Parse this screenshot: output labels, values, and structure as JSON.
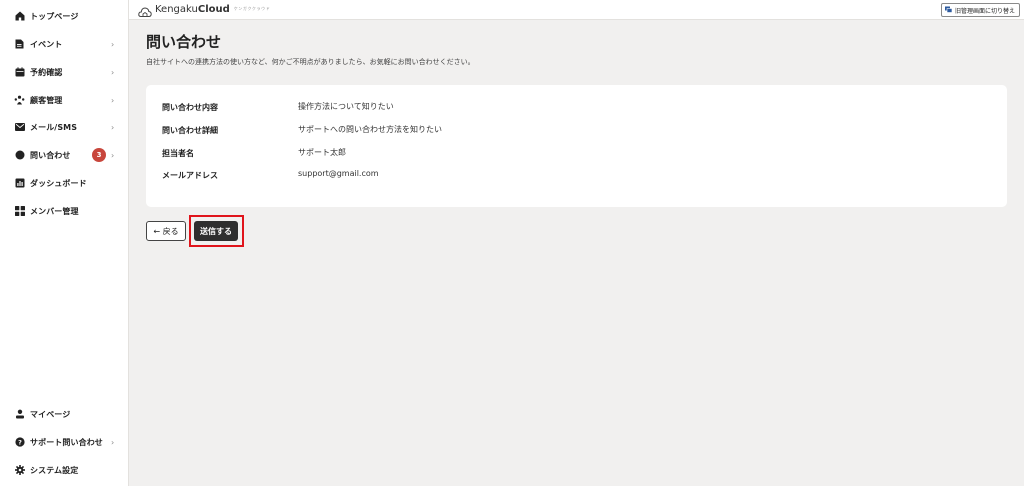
{
  "sidebar": {
    "top_items": [
      {
        "label": "トップページ",
        "icon": "home-icon",
        "chevron": ""
      },
      {
        "label": "イベント",
        "icon": "document-icon",
        "chevron": "›"
      },
      {
        "label": "予約確認",
        "icon": "calendar-icon",
        "chevron": "›"
      },
      {
        "label": "顧客管理",
        "icon": "people-icon",
        "chevron": "›"
      },
      {
        "label": "メール/SMS",
        "icon": "mail-icon",
        "chevron": "›"
      },
      {
        "label": "問い合わせ",
        "icon": "chat-icon",
        "chevron": "›",
        "badge": "3"
      },
      {
        "label": "ダッシュボード",
        "icon": "chart-icon",
        "chevron": ""
      },
      {
        "label": "メンバー管理",
        "icon": "grid-icon",
        "chevron": ""
      }
    ],
    "bottom_items": [
      {
        "label": "マイページ",
        "icon": "user-icon",
        "chevron": ""
      },
      {
        "label": "サポート問い合わせ",
        "icon": "help-icon",
        "chevron": "›"
      },
      {
        "label": "システム設定",
        "icon": "gear-icon",
        "chevron": ""
      }
    ]
  },
  "header": {
    "logo_text_regular": "Kengaku",
    "logo_text_bold": "Cloud",
    "logo_sub": "ケンガククラウド",
    "switch_button_label": "旧管理画面に切り替え"
  },
  "main": {
    "title": "問い合わせ",
    "description": "自社サイトへの連携方法の使い方など、何かご不明点がありましたら、お気軽にお問い合わせください。",
    "rows": [
      {
        "label": "問い合わせ内容",
        "value": "操作方法について知りたい"
      },
      {
        "label": "問い合わせ詳細",
        "value": "サポートへの問い合わせ方法を知りたい"
      },
      {
        "label": "担当者名",
        "value": "サポート太郎"
      },
      {
        "label": "メールアドレス",
        "value": "support@gmail.com"
      }
    ],
    "back_button": "← 戻る",
    "submit_button": "送信する"
  },
  "colors": {
    "badge": "#c8463c",
    "submit_bg": "#2f2f2f",
    "highlight": "#e0141b",
    "background": "#f1f0ef"
  }
}
